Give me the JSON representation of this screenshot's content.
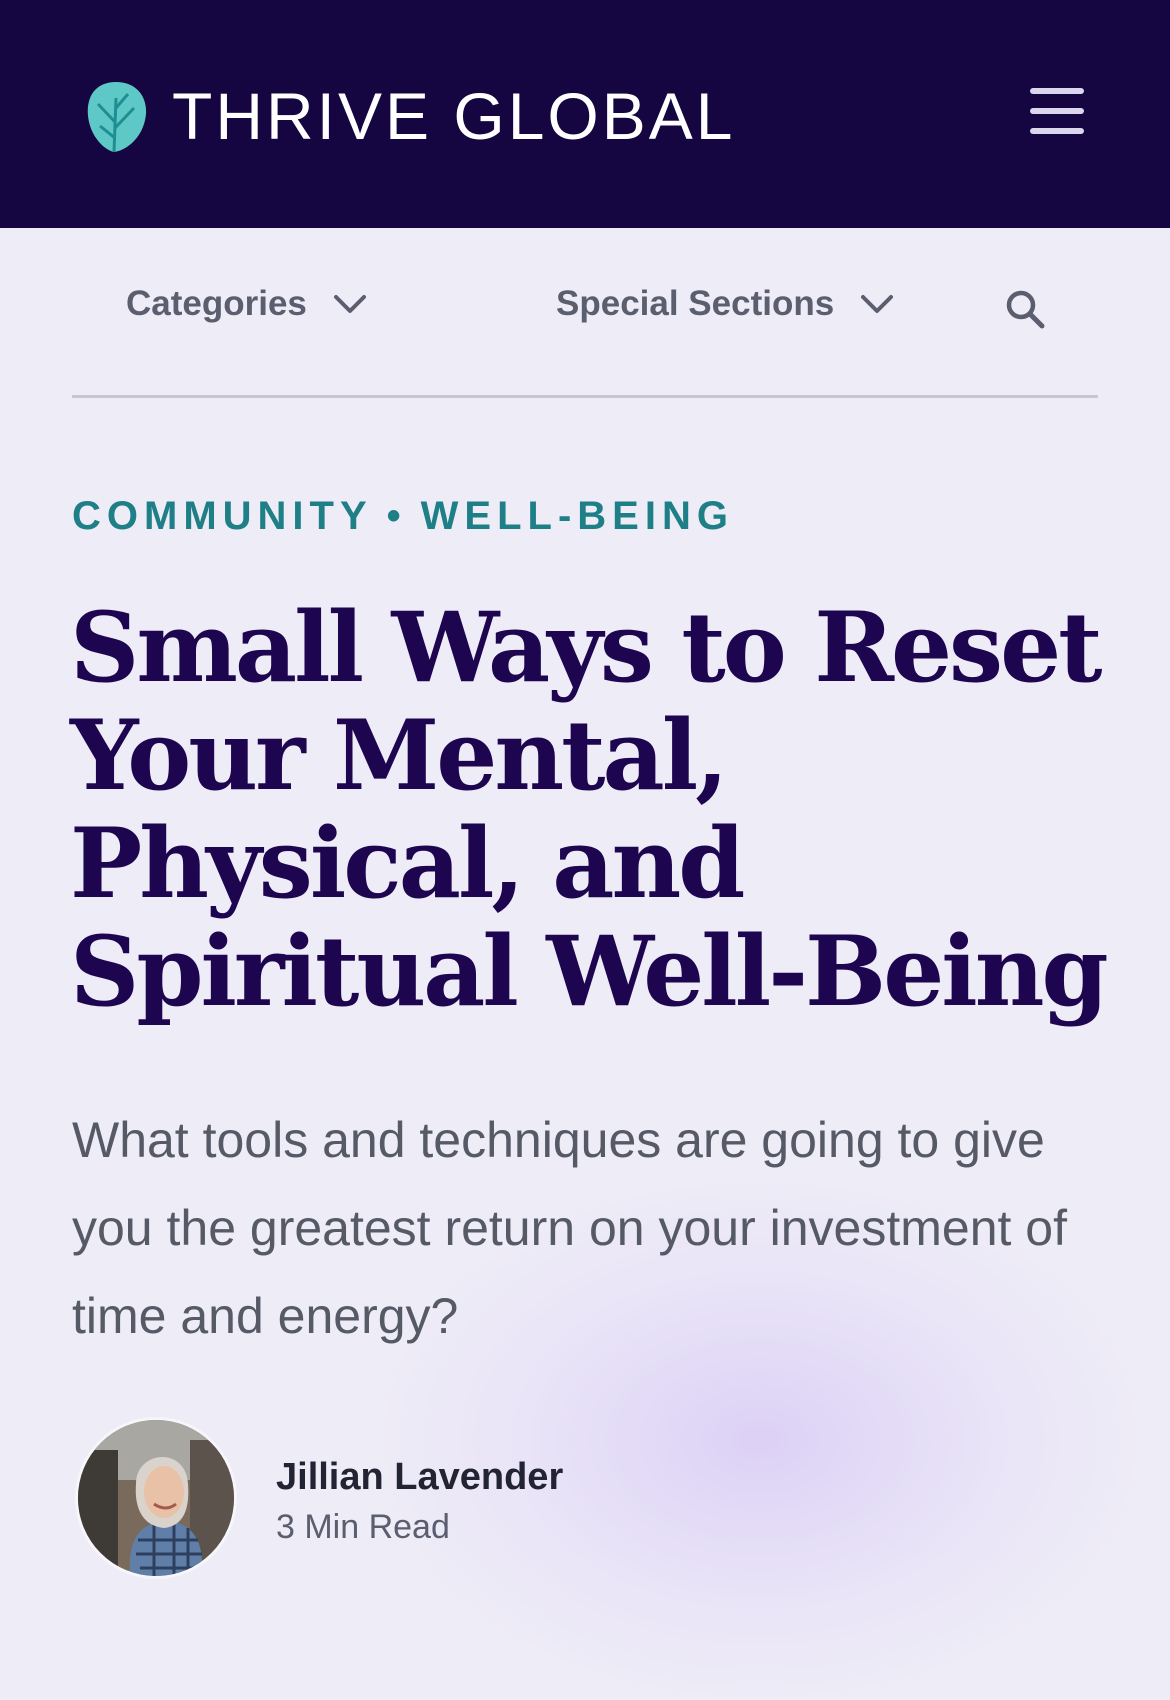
{
  "header": {
    "brand": "THRIVE GLOBAL",
    "logo_icon": "leaf-logo-icon",
    "menu_icon": "hamburger-menu-icon",
    "background_color": "#150540",
    "logo_color": "#5ec8c6"
  },
  "nav": {
    "categories_label": "Categories",
    "special_sections_label": "Special Sections",
    "dropdown_icon": "chevron-down-icon",
    "search_icon": "search-icon"
  },
  "article": {
    "category_primary": "COMMUNITY",
    "separator": "•",
    "category_secondary": "WELL-BEING",
    "title_lines": [
      "Small Ways to Reset",
      "Your Mental,",
      "Physical, and",
      "Spiritual Well-Being"
    ],
    "dek": "What tools and techniques are going to give you the greatest return on your investment of time and energy?",
    "author": {
      "name": "Jillian Lavender",
      "read_time": "3 Min Read"
    }
  },
  "colors": {
    "accent": "#1f7f86",
    "title": "#1d0550",
    "page_background": "#eeecf7"
  }
}
